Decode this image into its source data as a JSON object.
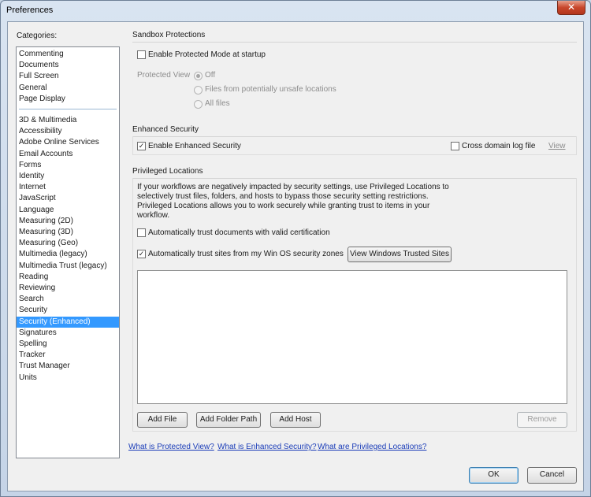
{
  "window": {
    "title": "Preferences",
    "close_glyph": "✕"
  },
  "categories": {
    "title": "Categories:",
    "group1": [
      "Commenting",
      "Documents",
      "Full Screen",
      "General",
      "Page Display"
    ],
    "group2": [
      "3D & Multimedia",
      "Accessibility",
      "Adobe Online Services",
      "Email Accounts",
      "Forms",
      "Identity",
      "Internet",
      "JavaScript",
      "Language",
      "Measuring (2D)",
      "Measuring (3D)",
      "Measuring (Geo)",
      "Multimedia (legacy)",
      "Multimedia Trust (legacy)",
      "Reading",
      "Reviewing",
      "Search",
      "Security",
      "Security (Enhanced)",
      "Signatures",
      "Spelling",
      "Tracker",
      "Trust Manager",
      "Units"
    ],
    "selected": "Security (Enhanced)"
  },
  "sandbox": {
    "title": "Sandbox Protections",
    "protected_mode": {
      "label": "Enable Protected Mode at startup",
      "checked": false
    },
    "protected_view": {
      "label": "Protected View",
      "options": [
        "Off",
        "Files from potentially unsafe locations",
        "All files"
      ],
      "selected": "Off"
    }
  },
  "enhanced": {
    "title": "Enhanced Security",
    "enable": {
      "label": "Enable Enhanced Security",
      "checked": true
    },
    "cross_domain": {
      "label": "Cross domain log file",
      "checked": false
    },
    "view_link": "View"
  },
  "privileged": {
    "title": "Privileged Locations",
    "description": "If your workflows are negatively impacted by security settings, use Privileged Locations to\nselectively trust files, folders, and hosts to bypass those security setting restrictions.\nPrivileged Locations allows you to work securely while granting trust to items in your\nworkflow.",
    "trust_certified": {
      "label": "Automatically trust documents with valid certification",
      "checked": false
    },
    "trust_sites": {
      "label": "Automatically trust sites from my Win OS security zones",
      "checked": true
    },
    "view_sites_button": "View Windows Trusted Sites",
    "locations": [],
    "add_file": "Add File",
    "add_folder": "Add Folder Path",
    "add_host": "Add Host",
    "remove": "Remove"
  },
  "links": {
    "protected_view": "What is Protected View?",
    "enhanced_security": "What is Enhanced Security?",
    "privileged_locations": "What are Privileged Locations?"
  },
  "footer": {
    "ok": "OK",
    "cancel": "Cancel"
  },
  "colors": {
    "selection": "#3399ff",
    "link": "#1a3cb8",
    "window_frame": "#c5d4e7"
  }
}
